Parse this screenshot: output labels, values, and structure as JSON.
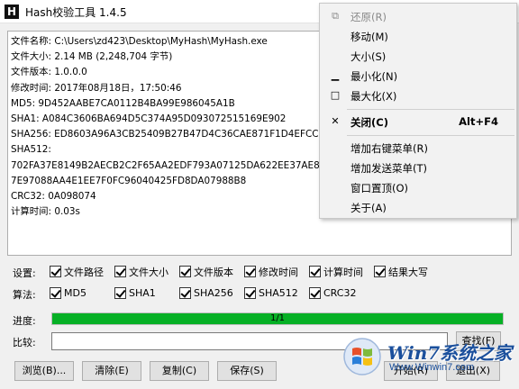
{
  "window": {
    "title": "Hash校验工具 1.4.5",
    "icon_letter": "H"
  },
  "results": {
    "lines": [
      "文件名称: C:\\Users\\zd423\\Desktop\\MyHash\\MyHash.exe",
      "文件大小: 2.14 MB (2,248,704 字节)",
      "文件版本: 1.0.0.0",
      "修改时间: 2017年08月18日，17:50:46",
      "MD5: 9D452AABE7CA0112B4BA99E986045A1B",
      "SHA1: A084C3606BA694D5C374A95D093072515169E902",
      "SHA256: ED8603A96A3CB25409B27B47D4C36CAE871F1D4EFCC6E3C0",
      "SHA512:",
      "702FA37E8149B2AECB2C2F65AA2EDF793A07125DA622EE37AE8FD399",
      "7E97088AA4E1EE7F0FC96040425FD8DA07988B8",
      "CRC32: 0A098074",
      "计算时间: 0.03s"
    ]
  },
  "settings": {
    "label": "设置:",
    "options": [
      {
        "label": "文件路径",
        "checked": true
      },
      {
        "label": "文件大小",
        "checked": true
      },
      {
        "label": "文件版本",
        "checked": true
      },
      {
        "label": "修改时间",
        "checked": true
      },
      {
        "label": "计算时间",
        "checked": true
      },
      {
        "label": "结果大写",
        "checked": true
      }
    ]
  },
  "algorithms": {
    "label": "算法:",
    "options": [
      {
        "label": "MD5",
        "checked": true
      },
      {
        "label": "SHA1",
        "checked": true
      },
      {
        "label": "SHA256",
        "checked": true
      },
      {
        "label": "SHA512",
        "checked": true
      },
      {
        "label": "CRC32",
        "checked": true
      }
    ]
  },
  "progress": {
    "label": "进度:",
    "text": "1/1",
    "fraction": 1.0,
    "color": "#06b025"
  },
  "compare": {
    "label": "比较:",
    "value": "",
    "find_button": "查找(F)"
  },
  "buttons": {
    "browse": "浏览(B)...",
    "clear": "清除(E)",
    "copy": "复制(C)",
    "save": "保存(S)",
    "start": "开始(R)",
    "exit": "退出(X)"
  },
  "system_menu": {
    "items": [
      {
        "label": "还原(R)",
        "icon": "restore-icon",
        "glyph": "⧉",
        "disabled": true
      },
      {
        "label": "移动(M)"
      },
      {
        "label": "大小(S)"
      },
      {
        "label": "最小化(N)",
        "icon": "minimize-icon",
        "glyph": "▁"
      },
      {
        "label": "最大化(X)",
        "icon": "maximize-icon",
        "glyph": "□"
      },
      {
        "label": "关闭(C)",
        "icon": "close-icon",
        "glyph": "✕",
        "shortcut": "Alt+F4",
        "bold": true
      },
      {
        "label": "增加右键菜单(R)"
      },
      {
        "label": "增加发送菜单(T)"
      },
      {
        "label": "窗口置顶(O)"
      },
      {
        "label": "关于(A)"
      }
    ]
  },
  "watermark": {
    "brand": "Win7系统之家",
    "url": "Www.Winwin7.com"
  }
}
